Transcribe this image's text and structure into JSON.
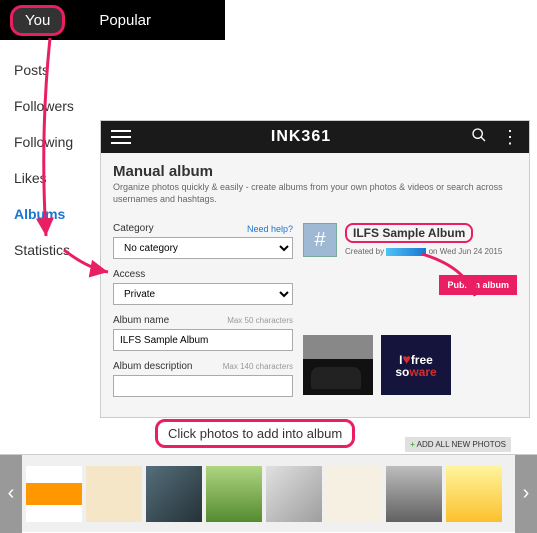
{
  "topTabs": {
    "you": "You",
    "popular": "Popular"
  },
  "sidebar": {
    "items": [
      "Posts",
      "Followers",
      "Following",
      "Likes",
      "Albums",
      "Statistics"
    ],
    "activeIndex": 4
  },
  "secondary": {
    "brand": "INK361",
    "title": "Manual album",
    "subtitle": "Organize photos quickly & easily - create albums from your own photos & videos or search across usernames and hashtags."
  },
  "form": {
    "categoryLabel": "Category",
    "helpLink": "Need help?",
    "categoryValue": "No category",
    "accessLabel": "Access",
    "accessValue": "Private",
    "albumNameLabel": "Album name",
    "albumNameHint": "Max 50 characters",
    "albumNameValue": "ILFS Sample Album",
    "descLabel": "Album description",
    "descHint": "Max 140 characters",
    "descValue": ""
  },
  "albumInfo": {
    "hash": "#",
    "name": "ILFS Sample Album",
    "createdPrefix": "Created by",
    "createdSuffix": "on Wed Jun 24 2015",
    "publish": "Publish album"
  },
  "callout": {
    "text": "Click photos to add into album"
  },
  "addAll": {
    "plus": "+",
    "text": " ADD ALL NEW PHOTOS"
  },
  "logoThumb": {
    "line1": "I",
    "heart": "♥",
    "line2": "free",
    "line3": "so",
    "line3b": "ware"
  },
  "nav": {
    "prev": "‹",
    "next": "›"
  }
}
